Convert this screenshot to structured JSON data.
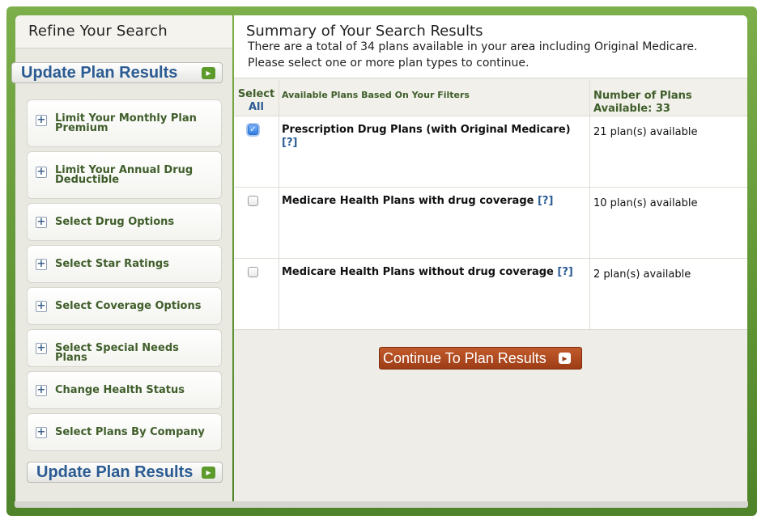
{
  "sidebar": {
    "title": "Refine Your Search",
    "update_label": "Update Plan Results",
    "filters": [
      {
        "label": "Limit Your Monthly Plan Premium"
      },
      {
        "label": "Limit Your Annual Drug Deductible"
      },
      {
        "label": "Select Drug Options"
      },
      {
        "label": "Select Star Ratings"
      },
      {
        "label": "Select Coverage Options"
      },
      {
        "label": "Select Special Needs Plans"
      },
      {
        "label": "Change Health Status"
      },
      {
        "label": "Select Plans By Company"
      }
    ]
  },
  "main": {
    "title": "Summary of Your Search Results",
    "line1": "There are a total of 34 plans available in your area including Original Medicare.",
    "line2": "Please select one or more plan types to continue.",
    "table": {
      "col_select_1": "Select",
      "col_select_2": "All",
      "col_plans": "Available Plans Based On Your Filters",
      "col_count_1": "Number of Plans",
      "col_count_2": "Available:  33",
      "help_text": "[?]",
      "rows": [
        {
          "name": "Prescription Drug Plans (with Original Medicare)",
          "count": "21 plan(s) available",
          "checked": true
        },
        {
          "name": "Medicare Health Plans with drug coverage",
          "count": "10 plan(s) available",
          "checked": false
        },
        {
          "name": "Medicare Health Plans without drug coverage",
          "count": "2 plan(s) available",
          "checked": false
        }
      ]
    },
    "continue_label": "Continue To Plan Results",
    "checkmark": "✓"
  },
  "colors": {
    "frame_green": "#5f9434",
    "label_green": "#3f5e2a",
    "link_blue": "#2b5b93",
    "continue_brown": "#9d3d16"
  }
}
